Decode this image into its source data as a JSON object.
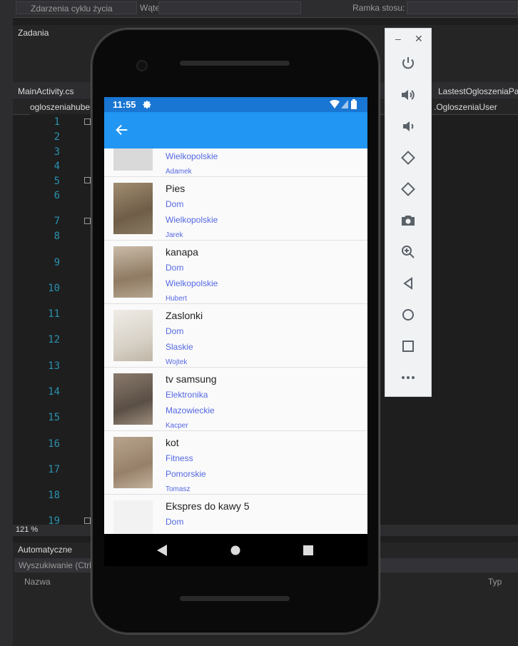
{
  "ide": {
    "toolbar": {
      "lifecycle_label": "Zdarzenia cyklu życia",
      "thread_label": "Wątek:",
      "stackframe_label": "Ramka stosu:"
    },
    "tasks_title": "Zadania",
    "tabs": [
      "MainActivity.cs",
      "LastestOgloszeniaPag"
    ],
    "editor_left": "ogloszeniahuber",
    "editor_right": ".OgloszeniaUser",
    "line_numbers": [
      "1",
      "2",
      "3",
      "4",
      "5",
      "6",
      "7",
      "8",
      "9",
      "10",
      "11",
      "12",
      "13",
      "14",
      "15",
      "16",
      "17",
      "18",
      "19"
    ],
    "zoom": "121 %",
    "autos_title": "Automatyczne",
    "autos_search": "Wyszukiwanie (Ctrl+",
    "col_name": "Nazwa",
    "col_type": "Typ"
  },
  "phone": {
    "time": "11:55",
    "items": [
      {
        "title": "",
        "category": "",
        "location": "Wielkopolskie",
        "user": "Adamek"
      },
      {
        "title": "Pies",
        "category": "Dom",
        "location": "Wielkopolskie",
        "user": "Jarek"
      },
      {
        "title": "kanapa",
        "category": "Dom",
        "location": "Wielkopolskie",
        "user": "Hubert"
      },
      {
        "title": "Zaslonki",
        "category": "Dom",
        "location": "Slaskie",
        "user": "Wojtek"
      },
      {
        "title": "tv samsung",
        "category": "Elektronika",
        "location": "Mazowieckie",
        "user": "Kacper"
      },
      {
        "title": "kot",
        "category": "Fitness",
        "location": "Pomorskie",
        "user": "Tomasz"
      },
      {
        "title": "Ekspres do kawy 5",
        "category": "Dom",
        "location": "",
        "user": ""
      }
    ]
  },
  "emulator": {
    "buttons": [
      "power-icon",
      "volume-up-icon",
      "volume-down-icon",
      "rotate-left-icon",
      "rotate-right-icon",
      "camera-icon",
      "zoom-icon",
      "back-icon",
      "home-icon",
      "overview-icon",
      "more-icon"
    ]
  },
  "colors": {
    "appbar": "#2196f3",
    "statusbar": "#1976d2",
    "link_text": "#5468e3",
    "ide_bg": "#1e1e1e"
  }
}
